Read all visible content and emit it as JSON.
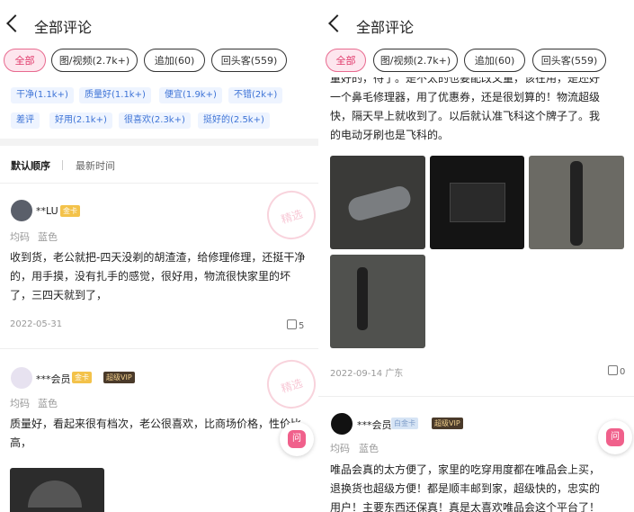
{
  "left": {
    "header": {
      "title": "全部评论"
    },
    "tabs": [
      "全部",
      "图/视频(2.7k+)",
      "追加(60)",
      "回头客(559)"
    ],
    "tags_row1": [
      "干净(1.1k+)",
      "质量好(1.1k+)",
      "便宜(1.9k+)",
      "不错(2k+)"
    ],
    "tags_row2": [
      "差评",
      "好用(2.1k+)",
      "很喜欢(2.3k+)",
      "挺好的(2.5k+)"
    ],
    "sort": {
      "default": "默认顺序",
      "latest": "最新时间"
    },
    "review1": {
      "user": "**LU",
      "badge": "金卡",
      "meta1": "均码",
      "meta2": "蓝色",
      "text": "收到货，老公就把-四天没剃的胡渣渣，给修理修理，还挺干净的，用手摸，没有扎手的感觉，很好用，物流很快家里的坏了，三四天就到了，",
      "date": "2022-05-31",
      "likes": "5",
      "stamp": "精选"
    },
    "review2": {
      "user": "***会员",
      "badge": "金卡",
      "vip": "超级VIP",
      "meta1": "均码",
      "meta2": "蓝色",
      "text": "质量好，看起来很有档次，老公很喜欢，比商场价格，性价比高，",
      "stamp": "精选"
    },
    "ask": "问"
  },
  "right": {
    "header": {
      "title": "全部评论"
    },
    "tabs": [
      "全部",
      "图/视频(2.7k+)",
      "追加(60)",
      "回头客(559)"
    ],
    "body_lines": [
      "量好的，待了。是不太的也要配改又量，该在用，是还好",
      "一个鼻毛修理器，用了优惠券，还是很划算的！物流超级",
      "快，隔天早上就收到了。以后就认准飞科这个牌子了。我",
      "的电动牙刷也是飞科的。"
    ],
    "date": "2022-09-14",
    "location": "广东",
    "likes": "0",
    "review2": {
      "user": "***会员",
      "badge": "白金卡",
      "vip": "超级VIP",
      "meta1": "均码",
      "meta2": "蓝色",
      "lines": [
        "唯品会真的太方便了，家里的吃穿用度都在唯品会上买，",
        "退换货也超级方便！都是顺丰邮到家，超级快的，忠实的",
        "用户！主要东西还保真！真是太喜欢唯品会这个平台了！"
      ]
    },
    "ask": "问"
  }
}
